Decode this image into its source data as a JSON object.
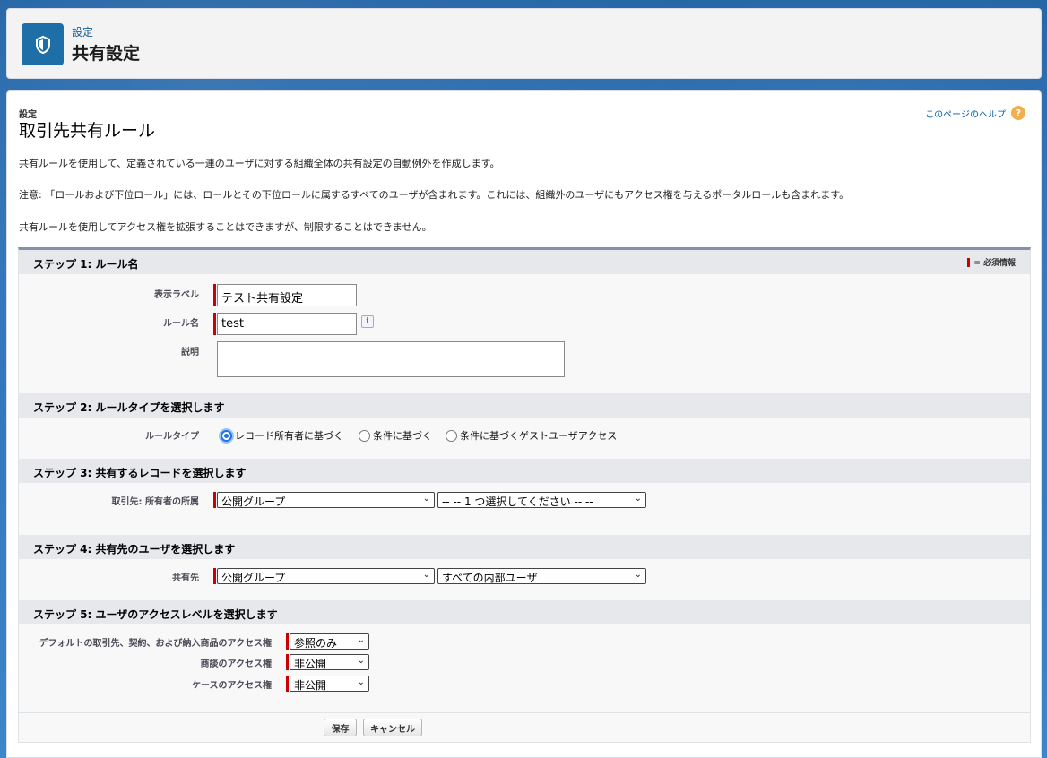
{
  "header": {
    "breadcrumb": "設定",
    "title": "共有設定",
    "icon": "shield-icon"
  },
  "page": {
    "eyebrow": "設定",
    "title": "取引先共有ルール",
    "help_link": "このページのヘルプ",
    "desc1": "共有ルールを使用して、定義されている一連のユーザに対する組織全体の共有設定の自動例外を作成します。",
    "desc2": "注意: 「ロールおよび下位ロール」には、ロールとその下位ロールに属するすべてのユーザが含まれます。これには、組織外のユーザにもアクセス権を与えるポータルロールも含まれます。",
    "desc3": "共有ルールを使用してアクセス権を拡張することはできますが、制限することはできません。"
  },
  "form": {
    "required_legend": "= 必須情報",
    "step1": {
      "title": "ステップ 1: ルール名",
      "label_label": "表示ラベル",
      "label_value": "テスト共有設定",
      "name_label": "ルール名",
      "name_value": "test",
      "info": "i",
      "desc_label": "説明"
    },
    "step2": {
      "title": "ステップ 2: ルールタイプを選択します",
      "type_label": "ルールタイプ",
      "options": [
        "レコード所有者に基づく",
        "条件に基づく",
        "条件に基づくゲストユーザアクセス"
      ]
    },
    "step3": {
      "title": "ステップ 3: 共有するレコードを選択します",
      "owner_label": "取引先: 所有者の所属",
      "owner_type": "公開グループ",
      "owner_value": "-- -- 1 つ選択してください -- --"
    },
    "step4": {
      "title": "ステップ 4: 共有先のユーザを選択します",
      "share_label": "共有先",
      "share_type": "公開グループ",
      "share_value": "すべての内部ユーザ"
    },
    "step5": {
      "title": "ステップ 5: ユーザのアクセスレベルを選択します",
      "default_label": "デフォルトの取引先、契約、および納入商品のアクセス権",
      "default_value": "参照のみ",
      "opp_label": "商談のアクセス権",
      "opp_value": "非公開",
      "case_label": "ケースのアクセス権",
      "case_value": "非公開"
    },
    "save": "保存",
    "cancel": "キャンセル"
  }
}
